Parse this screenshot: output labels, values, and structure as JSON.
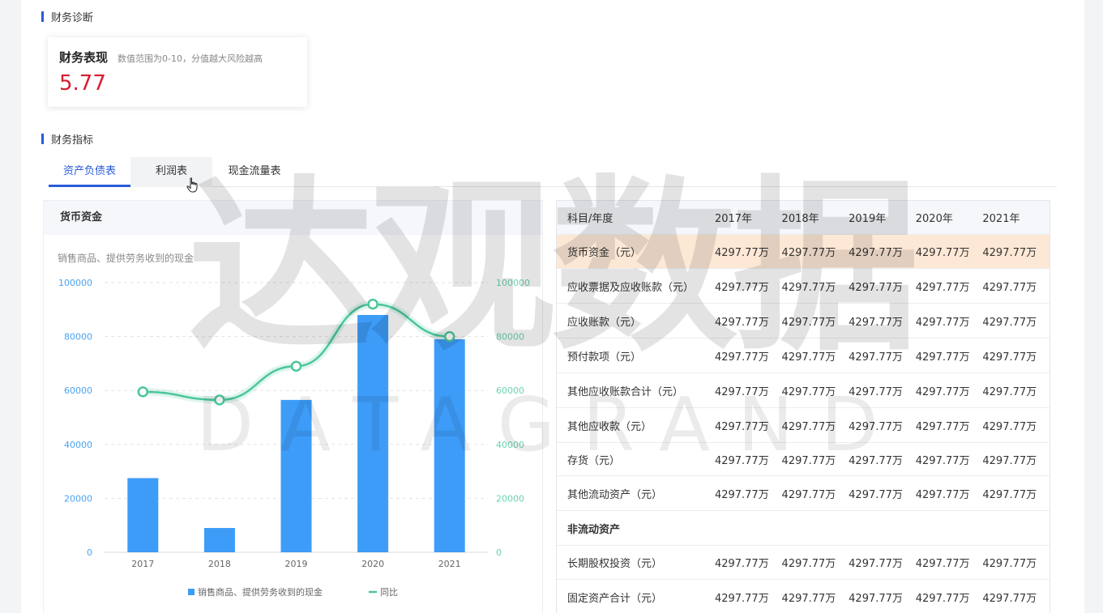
{
  "diagnosis": {
    "section_title": "财务诊断",
    "card_title": "财务表现",
    "card_desc": "数值范围为0-10，分值越大风险越高",
    "score": "5.77"
  },
  "indicators": {
    "section_title": "财务指标",
    "tabs": [
      {
        "label": "资产负债表",
        "active": true
      },
      {
        "label": "利润表",
        "active": false
      },
      {
        "label": "现金流量表",
        "active": false
      }
    ]
  },
  "chart_panel": {
    "title": "货币资金"
  },
  "chart_data": {
    "type": "bar",
    "title": "销售商品、提供劳务收到的现金",
    "categories": [
      "2017",
      "2018",
      "2019",
      "2020",
      "2021"
    ],
    "series": [
      {
        "name": "销售商品、提供劳务收到的现金",
        "type": "bar",
        "values": [
          27500,
          9000,
          56500,
          88000,
          79000
        ]
      },
      {
        "name": "同比",
        "type": "line",
        "values": [
          59500,
          56500,
          69000,
          92000,
          80000
        ]
      }
    ],
    "ylim": [
      0,
      100000
    ],
    "yticks": [
      "0",
      "20000",
      "40000",
      "60000",
      "80000",
      "100000"
    ],
    "y2ticks": [
      "0",
      "20000",
      "40000",
      "60000",
      "80000",
      "100000"
    ],
    "grid": true,
    "legend_position": "bottom",
    "colors": {
      "bar": "#3d9cf8",
      "line": "#4cc799",
      "left_axis": "#4aa3f0",
      "right_axis": "#6cd3ad"
    }
  },
  "table": {
    "header_label": "科目/年度",
    "years": [
      "2017年",
      "2018年",
      "2019年",
      "2020年",
      "2021年"
    ],
    "rows": [
      {
        "label": "货币资金（元）",
        "values": [
          "4297.77万",
          "4297.77万",
          "4297.77万",
          "4297.77万",
          "4297.77万"
        ],
        "highlight": true
      },
      {
        "label": "应收票据及应收账款（元）",
        "values": [
          "4297.77万",
          "4297.77万",
          "4297.77万",
          "4297.77万",
          "4297.77万"
        ]
      },
      {
        "label": "应收账款（元）",
        "values": [
          "4297.77万",
          "4297.77万",
          "4297.77万",
          "4297.77万",
          "4297.77万"
        ]
      },
      {
        "label": "预付款项（元）",
        "values": [
          "4297.77万",
          "4297.77万",
          "4297.77万",
          "4297.77万",
          "4297.77万"
        ]
      },
      {
        "label": "其他应收账款合计（元）",
        "values": [
          "4297.77万",
          "4297.77万",
          "4297.77万",
          "4297.77万",
          "4297.77万"
        ]
      },
      {
        "label": "其他应收款（元）",
        "values": [
          "4297.77万",
          "4297.77万",
          "4297.77万",
          "4297.77万",
          "4297.77万"
        ]
      },
      {
        "label": "存货（元）",
        "values": [
          "4297.77万",
          "4297.77万",
          "4297.77万",
          "4297.77万",
          "4297.77万"
        ]
      },
      {
        "label": "其他流动资产（元）",
        "values": [
          "4297.77万",
          "4297.77万",
          "4297.77万",
          "4297.77万",
          "4297.77万"
        ]
      },
      {
        "label": "非流动资产",
        "values": [],
        "group": true
      },
      {
        "label": "长期股权投资（元）",
        "values": [
          "4297.77万",
          "4297.77万",
          "4297.77万",
          "4297.77万",
          "4297.77万"
        ]
      },
      {
        "label": "固定资产合计（元）",
        "values": [
          "4297.77万",
          "4297.77万",
          "4297.77万",
          "4297.77万",
          "4297.77万"
        ]
      }
    ]
  },
  "watermark": {
    "main": "达观数据",
    "sub": "DATAGRAND"
  }
}
